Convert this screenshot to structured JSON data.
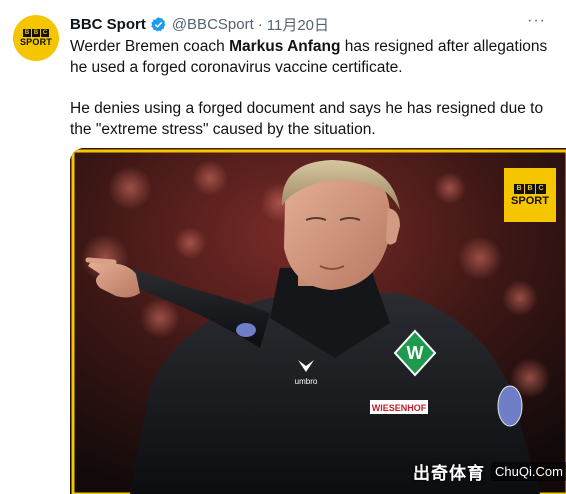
{
  "tweet": {
    "display_name": "BBC Sport",
    "handle": "@BBCSport",
    "separator": "·",
    "date": "11月20日",
    "more_glyph": "···",
    "avatar_bbc": [
      "B",
      "B",
      "C"
    ],
    "avatar_sport": "SPORT",
    "text_p1_before": "Werder Bremen coach ",
    "text_p1_bold": "Markus Anfang",
    "text_p1_after": " has resigned after allegations he used a forged coronavirus vaccine certificate.",
    "text_p2": "He denies using a forged document and says he has resigned due to the \"extreme stress\" caused by the situation."
  },
  "media": {
    "badge_bbc": [
      "B",
      "B",
      "C"
    ],
    "badge_sport": "SPORT",
    "shirt_text": "WIESENHOF",
    "crest_letter": "W",
    "jacket_brand": "umbro"
  },
  "watermark": {
    "chinese": "出奇体育",
    "site": "ChuQi.Com"
  },
  "colors": {
    "brand_yellow": "#f5c500",
    "verified_blue": "#1d9bf0",
    "werder_green": "#1d9a4d"
  }
}
